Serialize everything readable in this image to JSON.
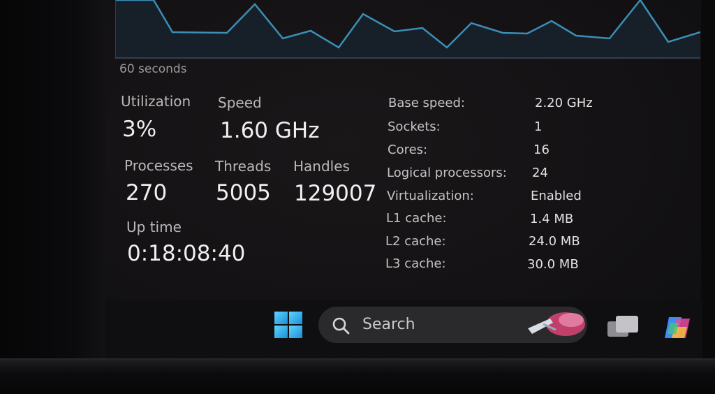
{
  "graph": {
    "time_label": "60 seconds",
    "line_color": "#3a8fb7"
  },
  "stats": {
    "utilization": {
      "label": "Utilization",
      "value": "3%"
    },
    "speed": {
      "label": "Speed",
      "value": "1.60 GHz"
    },
    "processes": {
      "label": "Processes",
      "value": "270"
    },
    "threads": {
      "label": "Threads",
      "value": "5005"
    },
    "handles": {
      "label": "Handles",
      "value": "129007"
    },
    "uptime": {
      "label": "Up time",
      "value": "0:18:08:40"
    }
  },
  "specs": [
    {
      "label": "Base speed:",
      "value": "2.20 GHz"
    },
    {
      "label": "Sockets:",
      "value": "1"
    },
    {
      "label": "Cores:",
      "value": "16"
    },
    {
      "label": "Logical processors:",
      "value": "24"
    },
    {
      "label": "Virtualization:",
      "value": "Enabled"
    },
    {
      "label": "L1 cache:",
      "value": "1.4 MB"
    },
    {
      "label": "L2 cache:",
      "value": "24.0 MB"
    },
    {
      "label": "L3 cache:",
      "value": "30.0 MB"
    }
  ],
  "taskbar": {
    "search_placeholder": "Search",
    "start_icon": "windows-logo-icon",
    "search_icon": "magnifier-icon",
    "taskview_icon": "task-view-icon",
    "copilot_icon": "copilot-icon",
    "accent": "#2fb4f0"
  }
}
